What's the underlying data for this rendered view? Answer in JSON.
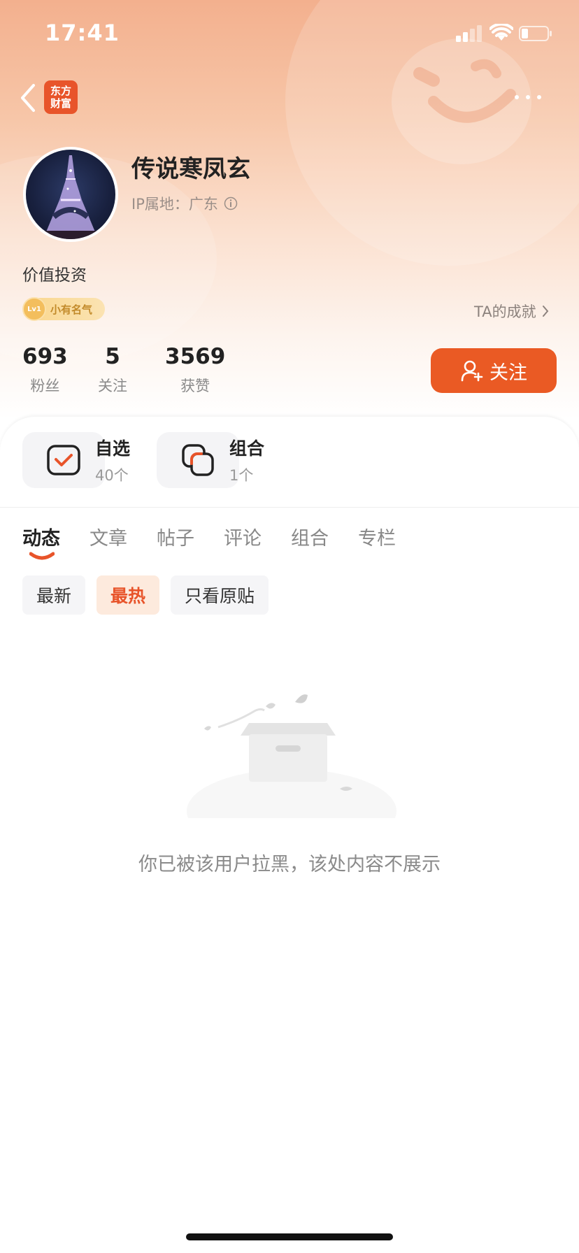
{
  "status_bar": {
    "time": "17:41"
  },
  "nav": {
    "logo_line1": "东方",
    "logo_line2": "财富"
  },
  "profile": {
    "name": "传说寒凤玄",
    "ip_location": "IP属地：广东",
    "bio": "价值投资",
    "badge_level": "Lv1",
    "badge_label": "小有名气",
    "achievements_link": "TA的成就"
  },
  "stats": [
    {
      "value": "693",
      "label": "粉丝"
    },
    {
      "value": "5",
      "label": "关注"
    },
    {
      "value": "3569",
      "label": "获赞"
    }
  ],
  "follow_button": {
    "label": "关注"
  },
  "shortcuts": [
    {
      "title": "自选",
      "count": "40个"
    },
    {
      "title": "组合",
      "count": "1个"
    }
  ],
  "tabs": [
    "动态",
    "文章",
    "帖子",
    "评论",
    "组合",
    "专栏"
  ],
  "active_tab": "动态",
  "filters": [
    "最新",
    "最热",
    "只看原贴"
  ],
  "active_filter": "最热",
  "empty_state": {
    "message": "你已被该用户拉黑，该处内容不展示"
  },
  "colors": {
    "accent": "#ea5a24",
    "badge": "#f9d68d",
    "header_top": "#f3b08e"
  }
}
